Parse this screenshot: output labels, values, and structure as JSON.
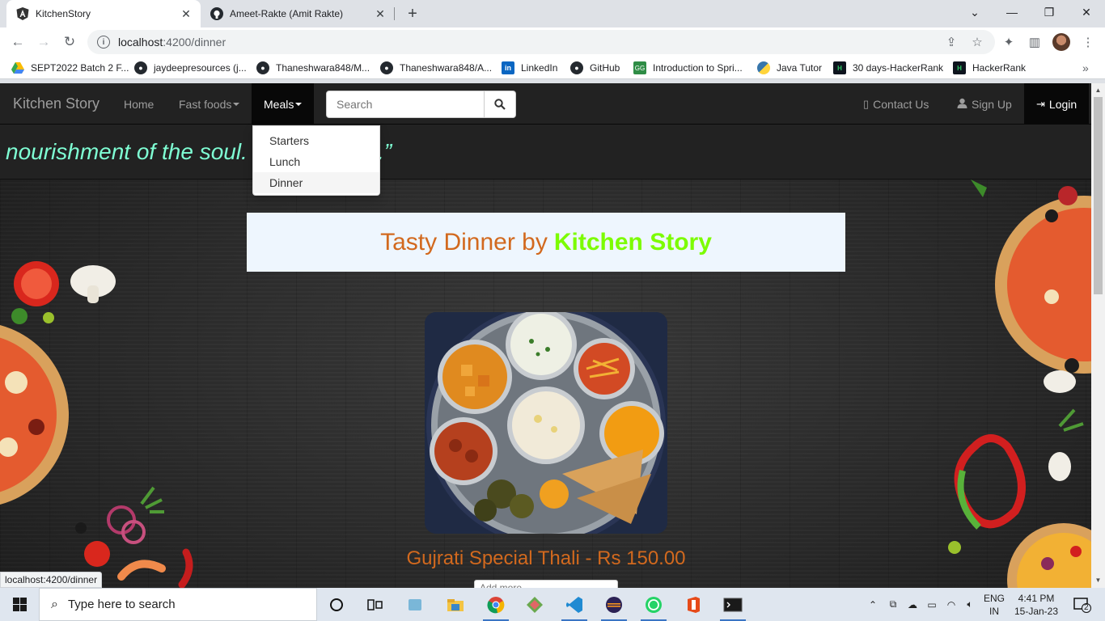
{
  "browser": {
    "tabs": [
      {
        "title": "KitchenStory",
        "icon": "angular-icon",
        "active": true
      },
      {
        "title": "Ameet-Rakte (Amit Rakte)",
        "icon": "github-icon",
        "active": false
      }
    ],
    "url_host": "localhost",
    "url_rest": ":4200/dinner",
    "bookmarks": [
      {
        "label": "SEPT2022 Batch 2 F...",
        "icon": "google-drive-icon"
      },
      {
        "label": "jaydeepresources (j...",
        "icon": "github-icon"
      },
      {
        "label": "Thaneshwara848/M...",
        "icon": "github-icon"
      },
      {
        "label": "Thaneshwara848/A...",
        "icon": "github-icon"
      },
      {
        "label": "LinkedIn",
        "icon": "linkedin-icon"
      },
      {
        "label": "GitHub",
        "icon": "github-icon"
      },
      {
        "label": "Introduction to Spri...",
        "icon": "geeksforgeeks-icon"
      },
      {
        "label": "Java Tutor",
        "icon": "python-icon"
      },
      {
        "label": "30 days-HackerRank",
        "icon": "hackerrank-icon"
      },
      {
        "label": "HackerRank",
        "icon": "hackerrank-icon"
      }
    ],
    "status_url": "localhost:4200/dinner"
  },
  "site": {
    "brand": "Kitchen Story",
    "nav": {
      "home": "Home",
      "fast_foods": "Fast foods",
      "meals": "Meals"
    },
    "search_placeholder": "Search",
    "contact": "Contact Us",
    "signup": "Sign Up",
    "login": "Login",
    "quote": "nourishment of the soul. it’s truly love.”",
    "meals_menu": [
      "Starters",
      "Lunch",
      "Dinner"
    ],
    "meals_menu_active": "Dinner",
    "banner_prefix": "Tasty Dinner by",
    "banner_brand": "Kitchen Story",
    "dish": {
      "name": "Gujrati Special Thali - Rs 150.00",
      "image": "thali-photo"
    },
    "add_more_placeholder": "Add more"
  },
  "colors": {
    "quote": "#7fffd4",
    "banner_text": "#d2691e",
    "banner_brand": "#7cfc00",
    "dish_title": "#d2691e"
  },
  "taskbar": {
    "search_placeholder": "Type here to search",
    "apps": [
      "task-view-icon",
      "widgets-icon",
      "file-explorer-icon",
      "chrome-icon",
      "app-icon",
      "vscode-icon",
      "eclipse-icon",
      "whatsapp-icon",
      "office-icon",
      "terminal-icon"
    ],
    "lang_top": "ENG",
    "lang_bottom": "IN",
    "time": "4:41 PM",
    "date": "15-Jan-23",
    "notification_count": "2"
  }
}
